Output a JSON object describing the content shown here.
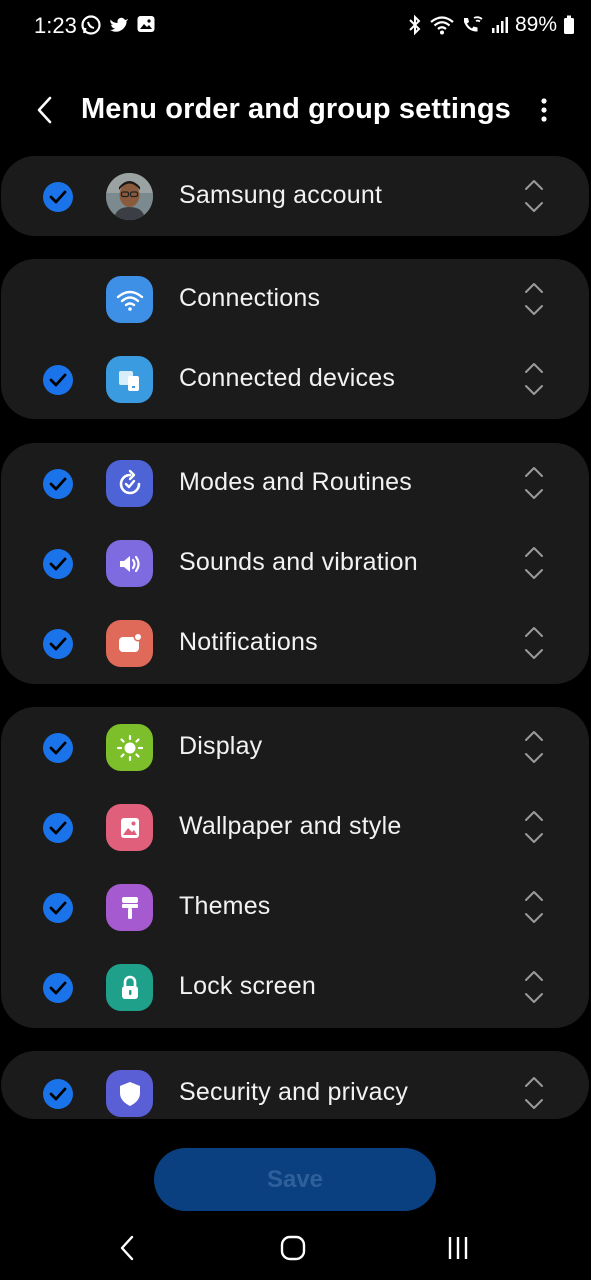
{
  "status_bar": {
    "time": "1:23",
    "left_icons": [
      "whatsapp-icon",
      "twitter-icon",
      "gallery-icon"
    ],
    "right_icons": [
      "bluetooth-icon",
      "wifi-icon",
      "wifi-calling-icon",
      "signal-icon",
      "battery-icon"
    ],
    "battery": "89%"
  },
  "header": {
    "title": "Menu order and group settings",
    "back_icon": "back-arrow-icon",
    "more_icon": "more-options-icon"
  },
  "groups": [
    {
      "items": [
        {
          "label": "Samsung account",
          "checked": true,
          "icon": "avatar",
          "color": "#6b5a4a"
        }
      ]
    },
    {
      "items": [
        {
          "label": "Connections",
          "checked": false,
          "icon": "wifi-icon",
          "color": "#3e8fe6"
        },
        {
          "label": "Connected devices",
          "checked": true,
          "icon": "devices-icon",
          "color": "#3a9be0"
        }
      ]
    },
    {
      "items": [
        {
          "label": "Modes and Routines",
          "checked": true,
          "icon": "routines-icon",
          "color": "#4d63d6"
        },
        {
          "label": "Sounds and vibration",
          "checked": true,
          "icon": "speaker-icon",
          "color": "#7e6be0"
        },
        {
          "label": "Notifications",
          "checked": true,
          "icon": "notification-icon",
          "color": "#e06a5a"
        }
      ]
    },
    {
      "items": [
        {
          "label": "Display",
          "checked": true,
          "icon": "sun-icon",
          "color": "#7cbf2a"
        },
        {
          "label": "Wallpaper and style",
          "checked": true,
          "icon": "wallpaper-icon",
          "color": "#e0607c"
        },
        {
          "label": "Themes",
          "checked": true,
          "icon": "brush-icon",
          "color": "#a65ad0"
        },
        {
          "label": "Lock screen",
          "checked": true,
          "icon": "lock-icon",
          "color": "#1fa08a"
        }
      ]
    },
    {
      "items": [
        {
          "label": "Security and privacy",
          "checked": true,
          "icon": "shield-icon",
          "color": "#5a5fd6"
        }
      ]
    }
  ],
  "save_label": "Save",
  "navbar": {
    "back_icon": "nav-back-icon",
    "home_icon": "nav-home-icon",
    "recents_icon": "nav-recents-icon"
  },
  "colors": {
    "background": "#000000",
    "card": "#1b1b1b",
    "check": "#1a73e8",
    "save_button": "#0a3f80"
  }
}
